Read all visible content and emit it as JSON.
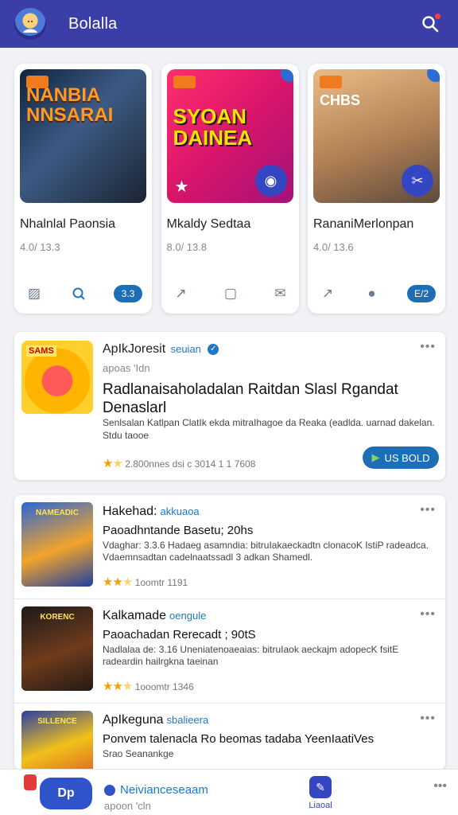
{
  "header": {
    "title": "Bolalla",
    "logo_icon": "mascot-logo",
    "search_icon": "search-icon"
  },
  "featured": [
    {
      "art_text": "NANBIA NNSARAI",
      "name": "Nhalnlal Paonsia",
      "meta": "4.0/ 13.3",
      "pill": "3.3",
      "tint": "#f07b1d"
    },
    {
      "art_text": "SYOAN DAINEA",
      "name": "Mkaldy Sedtaa",
      "meta": "8.0/ 13.8",
      "pill": "",
      "tint": "#ff2f6d"
    },
    {
      "art_text": "CHBS",
      "name": "RananiMerlonpan",
      "meta": "4.0/ 13.6",
      "pill": "E/2",
      "tint": "#e9bd86"
    }
  ],
  "promo": {
    "thumb_label": "SAMS",
    "developer": "ApIkJoresit",
    "dev_tag": "seuian",
    "subtitle": "apoas 'Idn",
    "headline": "Radlanaisaholadalan Raitdan Slasl Rgandat Denaslarl",
    "description": "Senlsalan Katlpan ClatIk ekda mitraIhagoe da Reaka (eadlda. uarnad dakelan.",
    "size_line": "Stdu taooe",
    "rating_text": "2.800nnes  dsi c 3014 1 1 7608",
    "cta_label": "US BOLD"
  },
  "list": [
    {
      "thumb_label": "NAMEADIC",
      "title": "Hakehad:",
      "tag": "akkuaoa",
      "line2": "Paoadhntande Basetu; 20hs",
      "line3": "Vdaghar: 3.3.6 Hadaeg asamndia: bitruIakaeckadtn clonacoK IstiP radeadca. Vdaemnsadtan cadelnaatssadl 3 adkan Shamedl.",
      "rating_text": "1oomtr  1191"
    },
    {
      "thumb_label": "KORENC",
      "title": "Kalkamade",
      "tag": "oengule",
      "line2": "Paoachadan Rerecadt ; 90tS",
      "line3": "Nadlalaa  de: 3.16 Uneniatenoaeaias: bitruIaok aeckajm adopecK fsitE radeardin hailrgkna taeinan",
      "rating_text": "1ooomtr  1346"
    },
    {
      "thumb_label": "SILLENCE",
      "title": "ApIkeguna",
      "tag": "sbalieera",
      "line2": "Ponvem talenacla Ro beomas tadaba YeenIaatiVes",
      "line3": "Srao Seanankge",
      "rating_text": ""
    }
  ],
  "bottombar": {
    "button_label": "Dp",
    "title": "Neivianceseaam",
    "subtitle": "apoon 'cln",
    "nav_label": "Liaoal"
  },
  "colors": {
    "header_bg": "#3b3ea6",
    "accent": "#1c6fb7",
    "link": "#1f77c8",
    "star": "#f5a200"
  }
}
